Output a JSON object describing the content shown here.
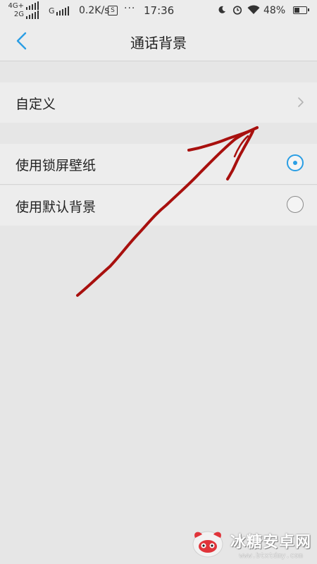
{
  "status_bar": {
    "network_top": "4G+",
    "network_bottom": "2G",
    "carrier_g": "G",
    "speed": "0.2K/s",
    "screenshot_glyph": "S",
    "dots": "···",
    "time": "17:36",
    "battery_text": "48%",
    "battery_level": 0.48
  },
  "header": {
    "title": "通话背景",
    "back_icon": "chevron-left-icon"
  },
  "options": {
    "custom": {
      "label": "自定义",
      "icon": "chevron-right-icon"
    },
    "lock_wallpaper": {
      "label": "使用锁屏壁纸",
      "selected": true
    },
    "default_bg": {
      "label": "使用默认背景",
      "selected": false
    }
  },
  "colors": {
    "accent": "#2a9ee4",
    "background": "#e6e6e6",
    "annotation": "#a8100e"
  },
  "watermark": {
    "title": "冰糖安卓网",
    "url": "www.btxtdmy.com"
  }
}
